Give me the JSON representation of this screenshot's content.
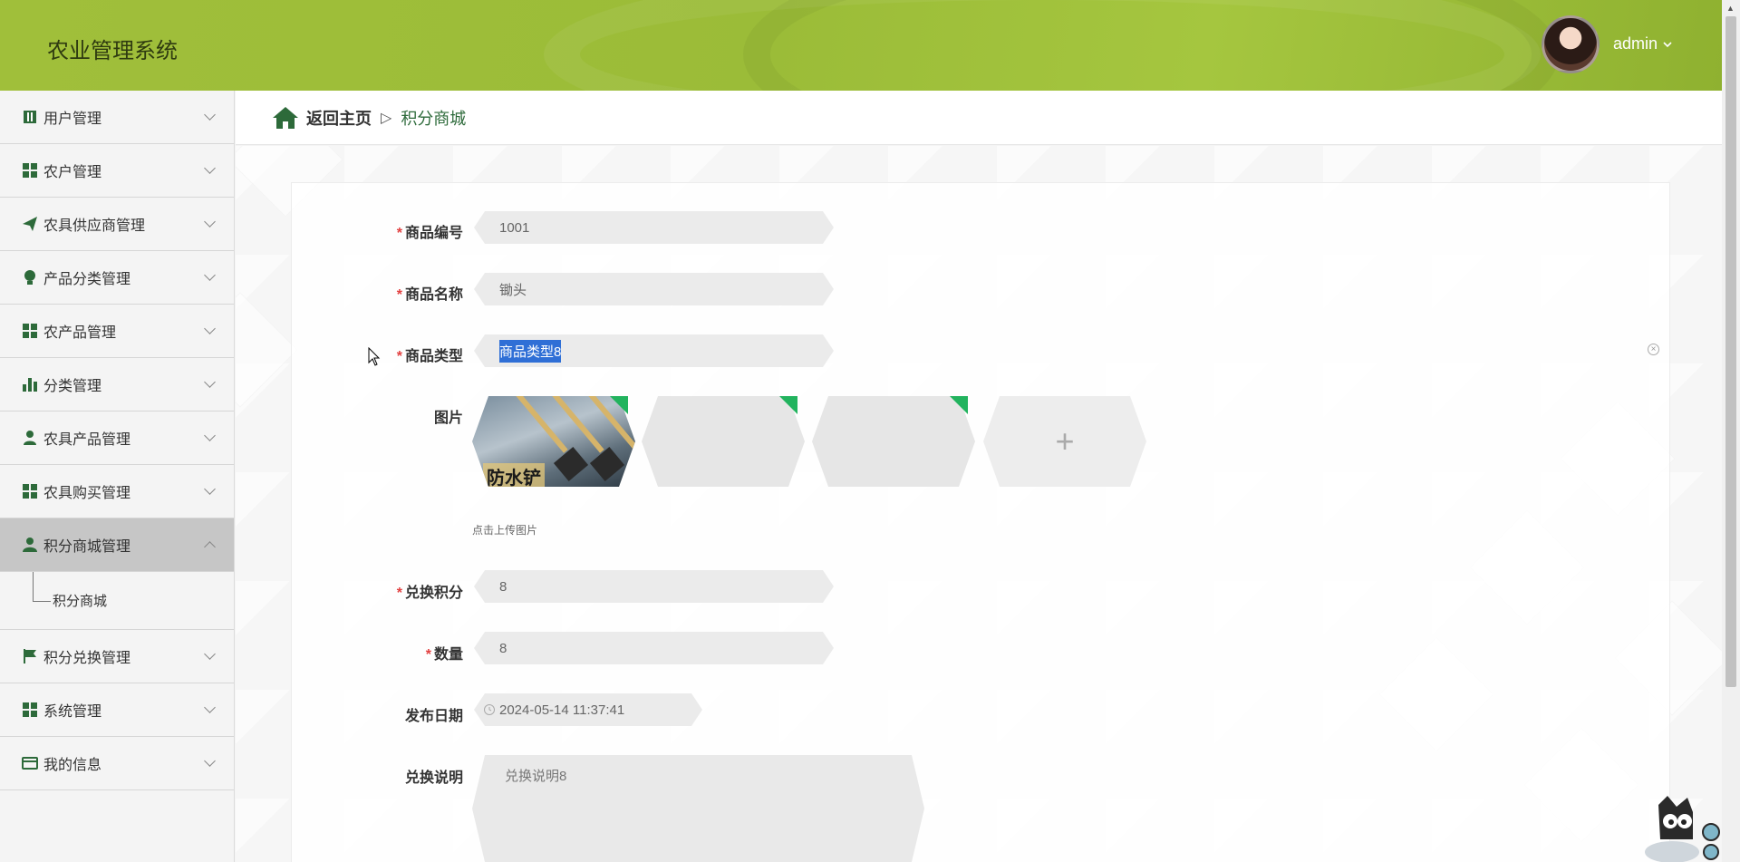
{
  "header": {
    "system_title": "农业管理系统",
    "username": "admin",
    "dropdown_icon": "chevron-down-icon"
  },
  "sidebar": {
    "items": [
      {
        "label": "用户管理",
        "icon": "book-icon"
      },
      {
        "label": "农户管理",
        "icon": "grid-icon"
      },
      {
        "label": "农具供应商管理",
        "icon": "paper-plane-icon"
      },
      {
        "label": "产品分类管理",
        "icon": "bulb-icon"
      },
      {
        "label": "农产品管理",
        "icon": "grid-icon"
      },
      {
        "label": "分类管理",
        "icon": "bar-chart-icon"
      },
      {
        "label": "农具产品管理",
        "icon": "user-icon"
      },
      {
        "label": "农具购买管理",
        "icon": "grid-icon"
      },
      {
        "label": "积分商城管理",
        "icon": "user-icon",
        "expanded": true
      },
      {
        "label": "积分兑换管理",
        "icon": "flag-icon"
      },
      {
        "label": "系统管理",
        "icon": "grid-icon"
      },
      {
        "label": "我的信息",
        "icon": "card-icon"
      }
    ],
    "sub_item": "积分商城"
  },
  "breadcrumb": {
    "home": "返回主页",
    "separator": "▷",
    "current": "积分商城"
  },
  "form": {
    "code_label": "商品编号",
    "code_value": "1001",
    "name_label": "商品名称",
    "name_value": "锄头",
    "type_label": "商品类型",
    "type_value": "商品类型8",
    "image_label": "图片",
    "image_caption": "防水铲",
    "upload_hint": "点击上传图片",
    "upload_plus": "+",
    "points_label": "兑换积分",
    "points_value": "8",
    "qty_label": "数量",
    "qty_value": "8",
    "date_label": "发布日期",
    "date_value": "2024-05-14 11:37:41",
    "desc_label": "兑换说明",
    "desc_value": "兑换说明8",
    "required_mark": "*",
    "clear_glyph": "×"
  },
  "colors": {
    "header_green": "#a0bf3a",
    "accent_green": "#2d6a3a",
    "required_red": "#e24040",
    "selection_blue": "#2f6fd6"
  }
}
